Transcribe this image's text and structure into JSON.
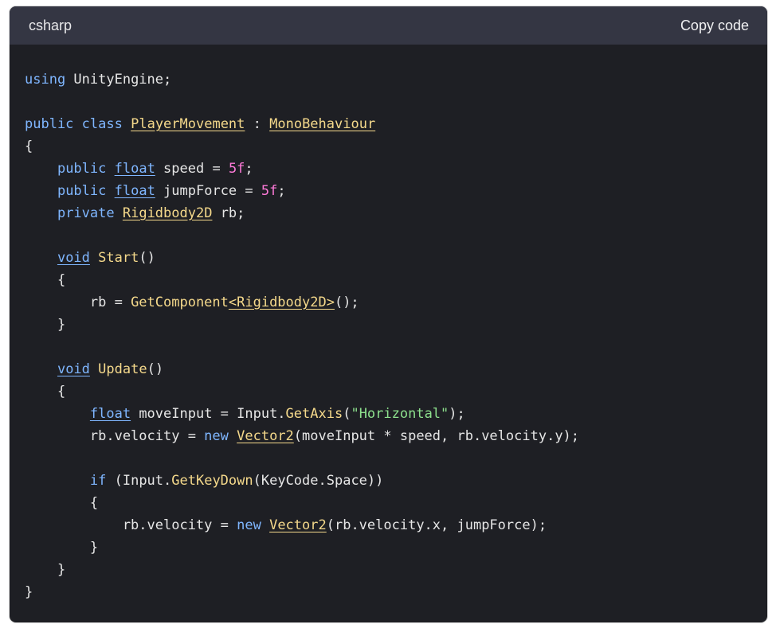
{
  "header": {
    "language": "csharp",
    "copy_label": "Copy code"
  },
  "code": {
    "lines": [
      [
        {
          "t": "kw",
          "v": "using"
        },
        {
          "t": "id",
          "v": " UnityEngine;"
        }
      ],
      [],
      [
        {
          "t": "kw",
          "v": "public"
        },
        {
          "t": "id",
          "v": " "
        },
        {
          "t": "kw",
          "v": "class"
        },
        {
          "t": "id",
          "v": " "
        },
        {
          "t": "cls",
          "v": "PlayerMovement"
        },
        {
          "t": "id",
          "v": " : "
        },
        {
          "t": "cls",
          "v": "MonoBehaviour"
        }
      ],
      [
        {
          "t": "id",
          "v": "{"
        }
      ],
      [
        {
          "t": "id",
          "v": "    "
        },
        {
          "t": "kw",
          "v": "public"
        },
        {
          "t": "id",
          "v": " "
        },
        {
          "t": "kwul",
          "v": "float"
        },
        {
          "t": "id",
          "v": " speed = "
        },
        {
          "t": "num",
          "v": "5f"
        },
        {
          "t": "id",
          "v": ";"
        }
      ],
      [
        {
          "t": "id",
          "v": "    "
        },
        {
          "t": "kw",
          "v": "public"
        },
        {
          "t": "id",
          "v": " "
        },
        {
          "t": "kwul",
          "v": "float"
        },
        {
          "t": "id",
          "v": " jumpForce = "
        },
        {
          "t": "num",
          "v": "5f"
        },
        {
          "t": "id",
          "v": ";"
        }
      ],
      [
        {
          "t": "id",
          "v": "    "
        },
        {
          "t": "kw",
          "v": "private"
        },
        {
          "t": "id",
          "v": " "
        },
        {
          "t": "cls",
          "v": "Rigidbody2D"
        },
        {
          "t": "id",
          "v": " rb;"
        }
      ],
      [],
      [
        {
          "t": "id",
          "v": "    "
        },
        {
          "t": "kwul",
          "v": "void"
        },
        {
          "t": "id",
          "v": " "
        },
        {
          "t": "fn",
          "v": "Start"
        },
        {
          "t": "id",
          "v": "()"
        }
      ],
      [
        {
          "t": "id",
          "v": "    {"
        }
      ],
      [
        {
          "t": "id",
          "v": "        rb = "
        },
        {
          "t": "fn",
          "v": "GetComponent"
        },
        {
          "t": "cls",
          "v": "<Rigidbody2D>"
        },
        {
          "t": "id",
          "v": "();"
        }
      ],
      [
        {
          "t": "id",
          "v": "    }"
        }
      ],
      [],
      [
        {
          "t": "id",
          "v": "    "
        },
        {
          "t": "kwul",
          "v": "void"
        },
        {
          "t": "id",
          "v": " "
        },
        {
          "t": "fn",
          "v": "Update"
        },
        {
          "t": "id",
          "v": "()"
        }
      ],
      [
        {
          "t": "id",
          "v": "    {"
        }
      ],
      [
        {
          "t": "id",
          "v": "        "
        },
        {
          "t": "kwul",
          "v": "float"
        },
        {
          "t": "id",
          "v": " moveInput = Input."
        },
        {
          "t": "fn",
          "v": "GetAxis"
        },
        {
          "t": "id",
          "v": "("
        },
        {
          "t": "str",
          "v": "\"Horizontal\""
        },
        {
          "t": "id",
          "v": ");"
        }
      ],
      [
        {
          "t": "id",
          "v": "        rb.velocity = "
        },
        {
          "t": "kw",
          "v": "new"
        },
        {
          "t": "id",
          "v": " "
        },
        {
          "t": "cls",
          "v": "Vector2"
        },
        {
          "t": "id",
          "v": "(moveInput * speed, rb.velocity.y);"
        }
      ],
      [],
      [
        {
          "t": "id",
          "v": "        "
        },
        {
          "t": "kw",
          "v": "if"
        },
        {
          "t": "id",
          "v": " (Input."
        },
        {
          "t": "fn",
          "v": "GetKeyDown"
        },
        {
          "t": "id",
          "v": "(KeyCode.Space))"
        }
      ],
      [
        {
          "t": "id",
          "v": "        {"
        }
      ],
      [
        {
          "t": "id",
          "v": "            rb.velocity = "
        },
        {
          "t": "kw",
          "v": "new"
        },
        {
          "t": "id",
          "v": " "
        },
        {
          "t": "cls",
          "v": "Vector2"
        },
        {
          "t": "id",
          "v": "(rb.velocity.x, jumpForce);"
        }
      ],
      [
        {
          "t": "id",
          "v": "        }"
        }
      ],
      [
        {
          "t": "id",
          "v": "    }"
        }
      ],
      [
        {
          "t": "id",
          "v": "}"
        }
      ]
    ]
  },
  "colors": {
    "card_bg": "#1e1f24",
    "header_bg": "#343643",
    "keyword": "#7fb6ff",
    "type": "#f5d98b",
    "number": "#ff7ad9",
    "string": "#8de08d"
  }
}
